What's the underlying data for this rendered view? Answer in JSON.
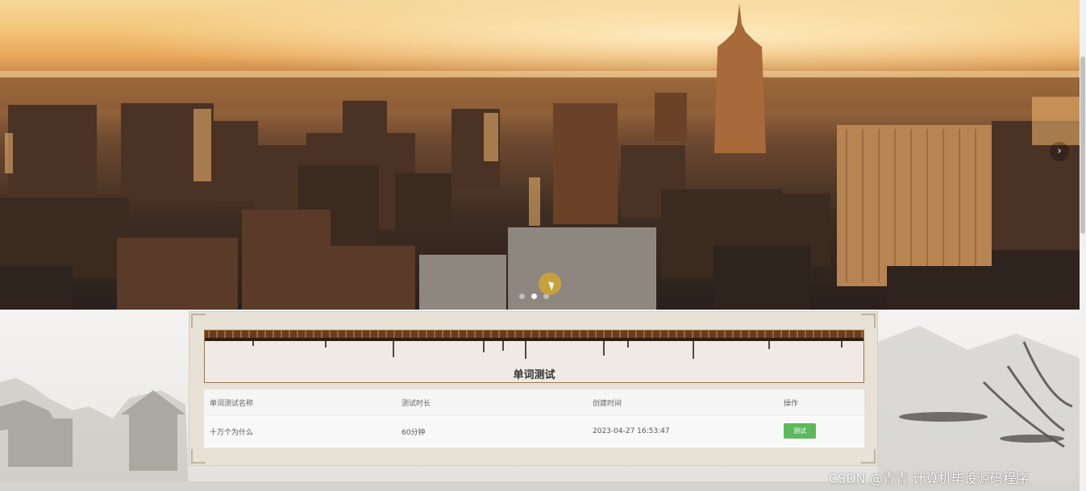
{
  "carousel": {
    "next_icon": "chevron-right-icon",
    "next_symbol": "›",
    "dots": [
      {
        "active": false
      },
      {
        "active": true
      },
      {
        "active": false
      }
    ]
  },
  "section": {
    "title": "单词测试"
  },
  "table": {
    "headers": [
      "单词测试名称",
      "测试时长",
      "创建时间",
      "操作"
    ],
    "rows": [
      {
        "name": "十万个为什么",
        "duration": "60分钟",
        "created": "2023-04-27 16:53:47",
        "action_label": "测试"
      }
    ]
  },
  "colors": {
    "action_button": "#5cb85c",
    "title_border": "#9b7650"
  },
  "watermark": "CSDN @青青  计算机毕设源码程序"
}
